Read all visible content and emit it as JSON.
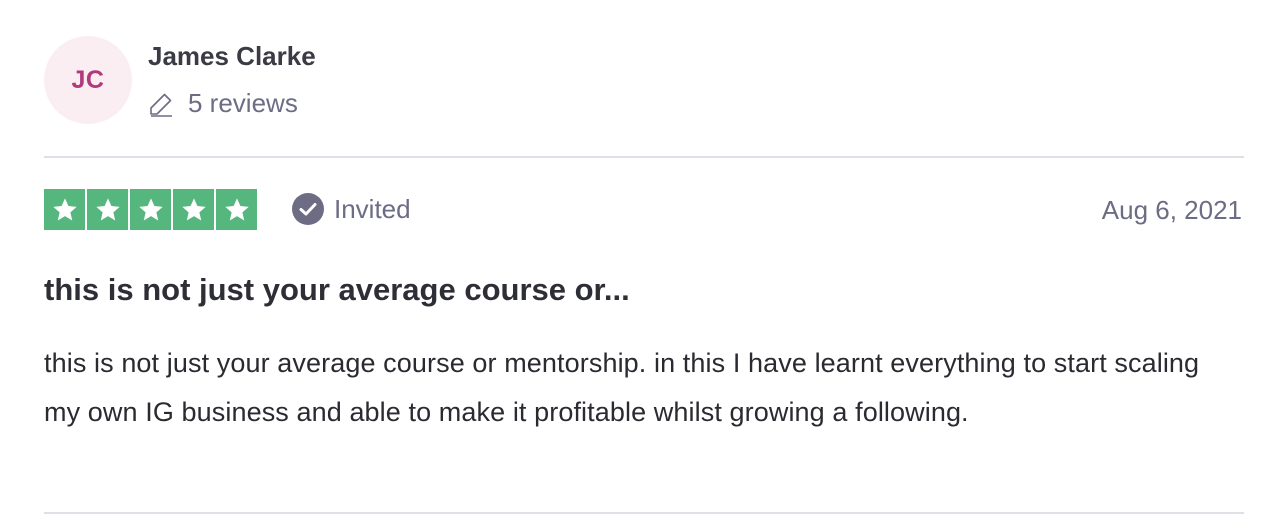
{
  "consumer": {
    "initials": "JC",
    "name": "James Clarke",
    "review_count": "5 reviews",
    "avatar_bg": "#fbeef3",
    "avatar_text_color": "#b23a7a"
  },
  "review": {
    "rating": 5,
    "rating_max": 5,
    "star_color": "#56b77e",
    "badge_label": "Invited",
    "badge_icon": "check-circle-icon",
    "date": "Aug 6, 2021",
    "title": "this is not just your average course or...",
    "body": "this is not just your average course or mentorship. in this I have learnt everything to start scaling my own IG business and able to make it profitable whilst growing a following."
  },
  "icons": {
    "reviews": "pencil-icon",
    "star": "star-icon"
  }
}
